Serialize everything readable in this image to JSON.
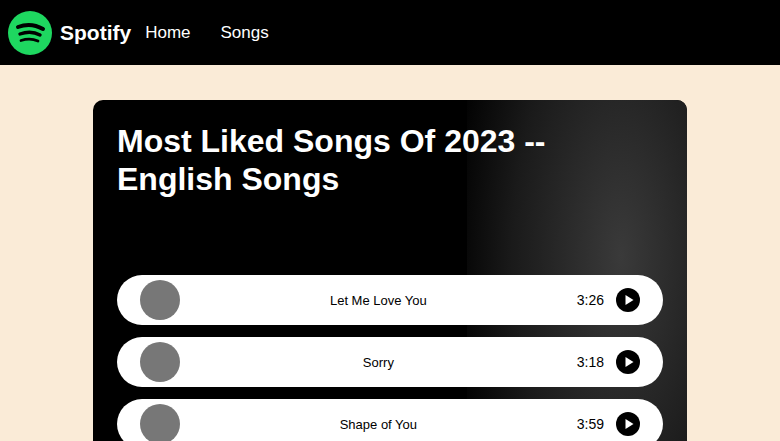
{
  "nav": {
    "brand": "Spotify",
    "links": [
      {
        "label": "Home"
      },
      {
        "label": "Songs"
      }
    ]
  },
  "playlist": {
    "title": "Most Liked Songs Of 2023 -- English Songs",
    "songs": [
      {
        "title": "Let Me Love You",
        "duration": "3:26"
      },
      {
        "title": "Sorry",
        "duration": "3:18"
      },
      {
        "title": "Shape of You",
        "duration": "3:59"
      }
    ]
  }
}
